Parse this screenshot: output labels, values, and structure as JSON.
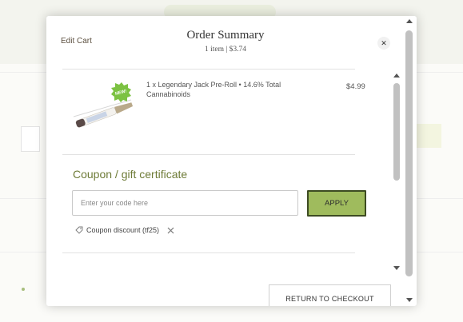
{
  "modal": {
    "edit_cart": "Edit Cart",
    "title": "Order Summary",
    "subtitle": "1 item | $3.74",
    "close_glyph": "✕",
    "return_button": "RETURN TO CHECKOUT"
  },
  "cart": {
    "items": [
      {
        "name": "1 x Legendary Jack Pre-Roll • 14.6% Total Cannabinoids",
        "price": "$4.99",
        "badge": "NEW!",
        "image_icon": "pre-roll-product-image"
      }
    ]
  },
  "coupon": {
    "title": "Coupon / gift certificate",
    "placeholder": "Enter your code here",
    "value": "",
    "apply_label": "APPLY",
    "applied": {
      "label": "Coupon discount (tf25)",
      "icon": "tag-icon",
      "remove_icon": "close-icon"
    }
  },
  "colors": {
    "accent_green": "#9fbb5d",
    "coupon_title": "#6e7b37",
    "apply_border": "#3d4b22",
    "badge_green": "#7cc242"
  }
}
